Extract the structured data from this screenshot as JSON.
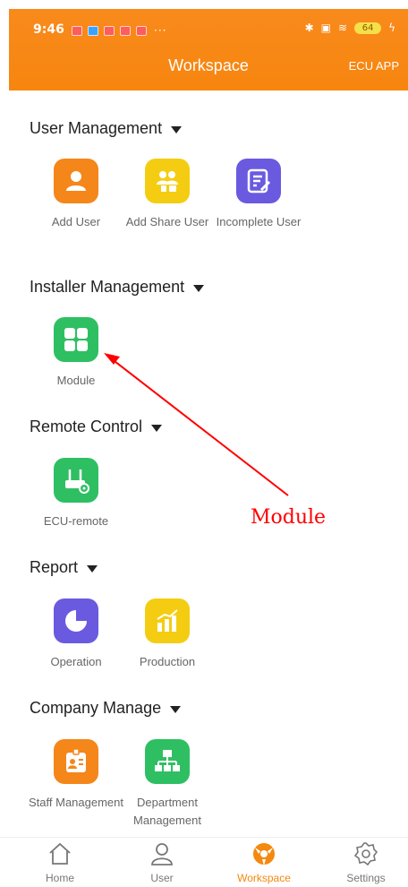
{
  "status_bar": {
    "time": "9:46",
    "more": "···",
    "battery": "64"
  },
  "header": {
    "title": "Workspace",
    "right_link": "ECU APP"
  },
  "colors": {
    "accent": "#f7860f",
    "orange_icon": "#f5861a",
    "yellow_icon": "#f4cd12",
    "purple_icon": "#6a5ae0",
    "green_icon": "#2fbf63",
    "annotation": "#ff0000"
  },
  "sections": {
    "user_management": {
      "title": "User Management",
      "items": [
        {
          "label": "Add User",
          "icon": "user-icon"
        },
        {
          "label": "Add Share User",
          "icon": "share-users-icon"
        },
        {
          "label": "Incomplete User",
          "icon": "edit-document-icon"
        }
      ]
    },
    "installer_management": {
      "title": "Installer Management",
      "items": [
        {
          "label": "Module",
          "icon": "grid-icon"
        }
      ]
    },
    "remote_control": {
      "title": "Remote Control",
      "items": [
        {
          "label": "ECU-remote",
          "icon": "router-gear-icon"
        }
      ]
    },
    "report": {
      "title": "Report",
      "items": [
        {
          "label": "Operation",
          "icon": "pie-chart-icon"
        },
        {
          "label": "Production",
          "icon": "bar-chart-icon"
        }
      ]
    },
    "company_manage": {
      "title": "Company Manage",
      "items": [
        {
          "label": "Staff Management",
          "icon": "badge-icon"
        },
        {
          "label": "Department Management",
          "icon": "org-chart-icon"
        }
      ]
    }
  },
  "annotation": {
    "text": "Module"
  },
  "bottom_nav": {
    "items": [
      {
        "label": "Home",
        "icon": "home-icon"
      },
      {
        "label": "User",
        "icon": "user-outline-icon"
      },
      {
        "label": "Workspace",
        "icon": "workspace-icon",
        "active": true
      },
      {
        "label": "Settings",
        "icon": "settings-gear-icon"
      }
    ]
  }
}
